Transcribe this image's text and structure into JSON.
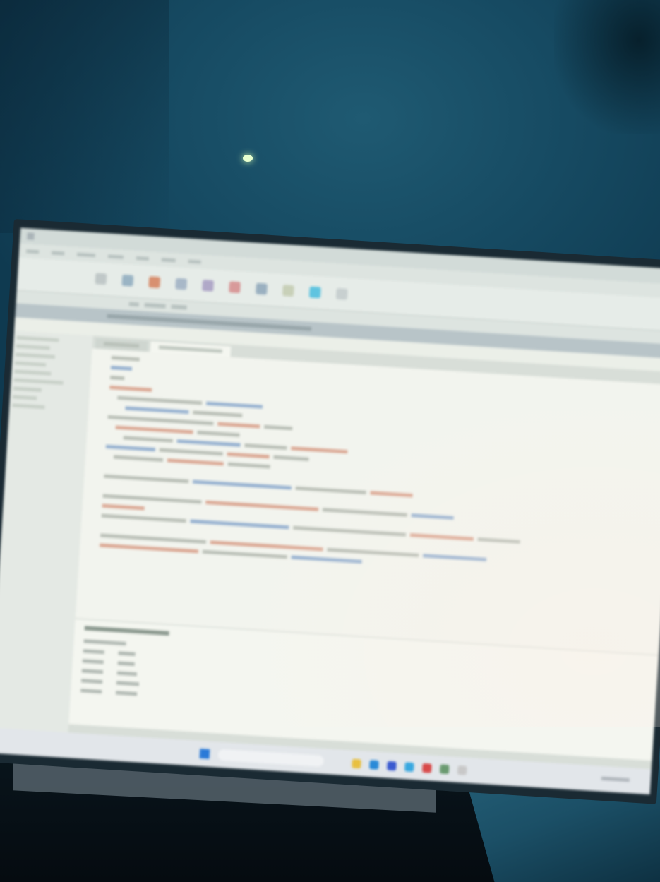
{
  "screen": {
    "path": "",
    "nav_items": [
      "",
      "",
      "",
      "",
      "",
      "",
      "",
      "",
      "",
      "",
      ""
    ],
    "tabs": [
      {
        "label": ""
      },
      {
        "label": ""
      }
    ],
    "results_title": "",
    "search_placeholder": ""
  },
  "colors": {
    "wall": "#164a62",
    "screen_bg": "#ebefe8",
    "active_ribbon_button": "#5fc4e0",
    "keyword": "#4a7ab8",
    "string": "#c86a4a",
    "start_button": "#2a7ad8"
  },
  "icons": [
    "start-icon",
    "search-icon",
    "file-explorer-icon",
    "edge-icon",
    "store-icon",
    "mail-icon",
    "app-icon"
  ]
}
